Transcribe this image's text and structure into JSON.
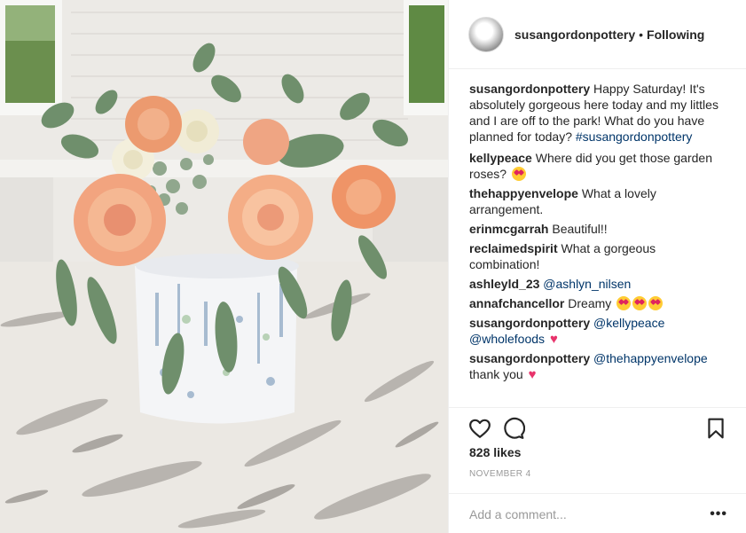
{
  "post": {
    "username": "susangordonpottery",
    "separator": "•",
    "follow_status": "Following",
    "likes": "828 likes",
    "date": "NOVEMBER 4",
    "comment_placeholder": "Add a comment...",
    "more": "•••"
  },
  "caption": {
    "user": "susangordonpottery",
    "text": "Happy Saturday! It's absolutely gorgeous here today and my littles and I are off to the park! What do you have planned for today?",
    "hashtag": "#susangordonpottery"
  },
  "comments": [
    {
      "user": "kellypeace",
      "text": "Where did you get those garden roses?"
    },
    {
      "user": "thehappyenvelope",
      "text": "What a lovely arrangement."
    },
    {
      "user": "erinmcgarrah",
      "text": "Beautiful!!"
    },
    {
      "user": "reclaimedspirit",
      "text": "What a gorgeous combination!"
    },
    {
      "user": "ashleyld_23",
      "mention": "@ashlyn_nilsen"
    },
    {
      "user": "annafchancellor",
      "text": "Dreamy"
    },
    {
      "user": "susangordonpottery",
      "mention": "@kellypeace",
      "mention2": "@wholefoods"
    },
    {
      "user": "susangordonpottery",
      "mention": "@thehappyenvelope",
      "text": "thank you"
    }
  ],
  "icons": {
    "like": "heart-icon",
    "comment": "comment-icon",
    "save": "bookmark-icon",
    "emoji_heart_eyes": "heart-eyes-emoji",
    "emoji_two_hearts": "two-hearts-emoji",
    "emoji_sparkle_heart": "sparkling-heart-emoji"
  },
  "colors": {
    "text": "#262626",
    "link": "#003569",
    "muted": "#999999",
    "divider": "#efefef",
    "emoji_heart": "#e8336b"
  }
}
